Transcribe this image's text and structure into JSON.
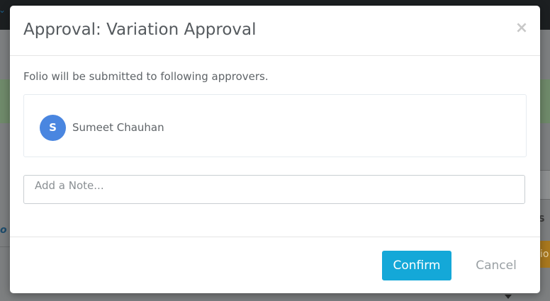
{
  "background": {
    "left_partial_text": "o",
    "right_partial_s": "S",
    "right_partial_button": "io"
  },
  "modal": {
    "title": "Approval: Variation Approval",
    "close_glyph": "×",
    "intro": "Folio will be submitted to following approvers.",
    "approvers": [
      {
        "initial": "S",
        "name": "Sumeet Chauhan",
        "avatar_color": "#4a86e0"
      }
    ],
    "note": {
      "value": "",
      "placeholder": "Add a Note..."
    },
    "footer": {
      "confirm_label": "Confirm",
      "cancel_label": "Cancel"
    }
  },
  "colors": {
    "accent": "#14a8d8",
    "avatar": "#4a86e0"
  }
}
